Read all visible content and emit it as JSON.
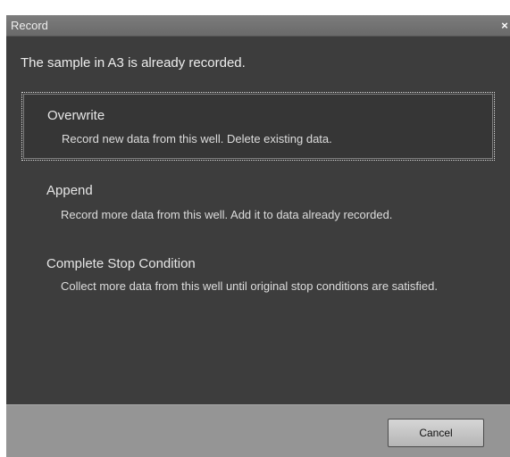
{
  "dialog": {
    "title": "Record",
    "close_glyph": "×"
  },
  "message": "The sample in A3 is already recorded.",
  "options": [
    {
      "title": "Overwrite",
      "description": "Record new data from this well. Delete existing data.",
      "selected": true
    },
    {
      "title": "Append",
      "description": "Record more data from this well. Add it to data already recorded.",
      "selected": false
    },
    {
      "title": "Complete Stop Condition",
      "description": "Collect more data from this well until original stop conditions are satisfied.",
      "selected": false
    }
  ],
  "footer": {
    "cancel_label": "Cancel"
  }
}
